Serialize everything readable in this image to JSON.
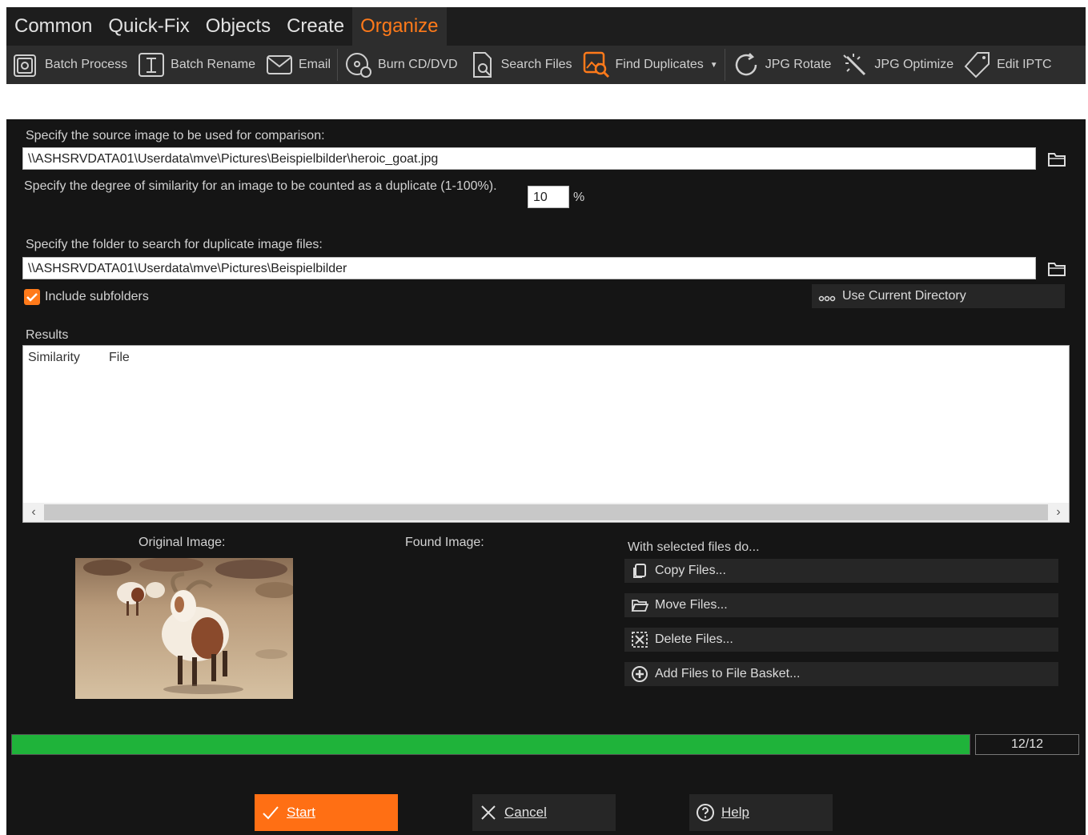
{
  "menu": {
    "tabs": [
      {
        "label": "Common"
      },
      {
        "label": "Quick-Fix"
      },
      {
        "label": "Objects"
      },
      {
        "label": "Create"
      },
      {
        "label": "Organize",
        "active": true
      }
    ]
  },
  "toolbar": {
    "batch_process": "Batch Process",
    "batch_rename": "Batch Rename",
    "email": "Email",
    "burn": "Burn CD/DVD",
    "search_files": "Search Files",
    "find_duplicates": "Find Duplicates",
    "jpg_rotate": "JPG Rotate",
    "jpg_optimize": "JPG Optimize",
    "edit_iptc": "Edit IPTC"
  },
  "dialog": {
    "source_label": "Specify the source image to be used for comparison:",
    "source_path": "\\\\ASHSRVDATA01\\Userdata\\mve\\Pictures\\Beispielbilder\\heroic_goat.jpg",
    "similarity_label": "Specify the degree of similarity for an image to be counted as a duplicate (1-100%).",
    "similarity_value": "10",
    "similarity_unit": "%",
    "folder_label": "Specify the folder to search for duplicate image files:",
    "folder_path": "\\\\ASHSRVDATA01\\Userdata\\mve\\Pictures\\Beispielbilder",
    "include_subfolders": "Include subfolders",
    "use_current_directory": "Use Current Directory",
    "results_label": "Results",
    "col_similarity": "Similarity",
    "col_file": "File",
    "original_image_label": "Original Image:",
    "found_image_label": "Found Image:",
    "selected_files_label": "With selected files do...",
    "copy_files": "Copy Files...",
    "move_files": "Move Files...",
    "delete_files": "Delete Files...",
    "add_to_basket": "Add Files to File Basket...",
    "progress_fraction": 1.0,
    "progress_text": "12/12",
    "start": "Start",
    "cancel": "Cancel",
    "help": "Help"
  },
  "colors": {
    "accent": "#ff7a1a",
    "progress": "#1fb33a"
  }
}
